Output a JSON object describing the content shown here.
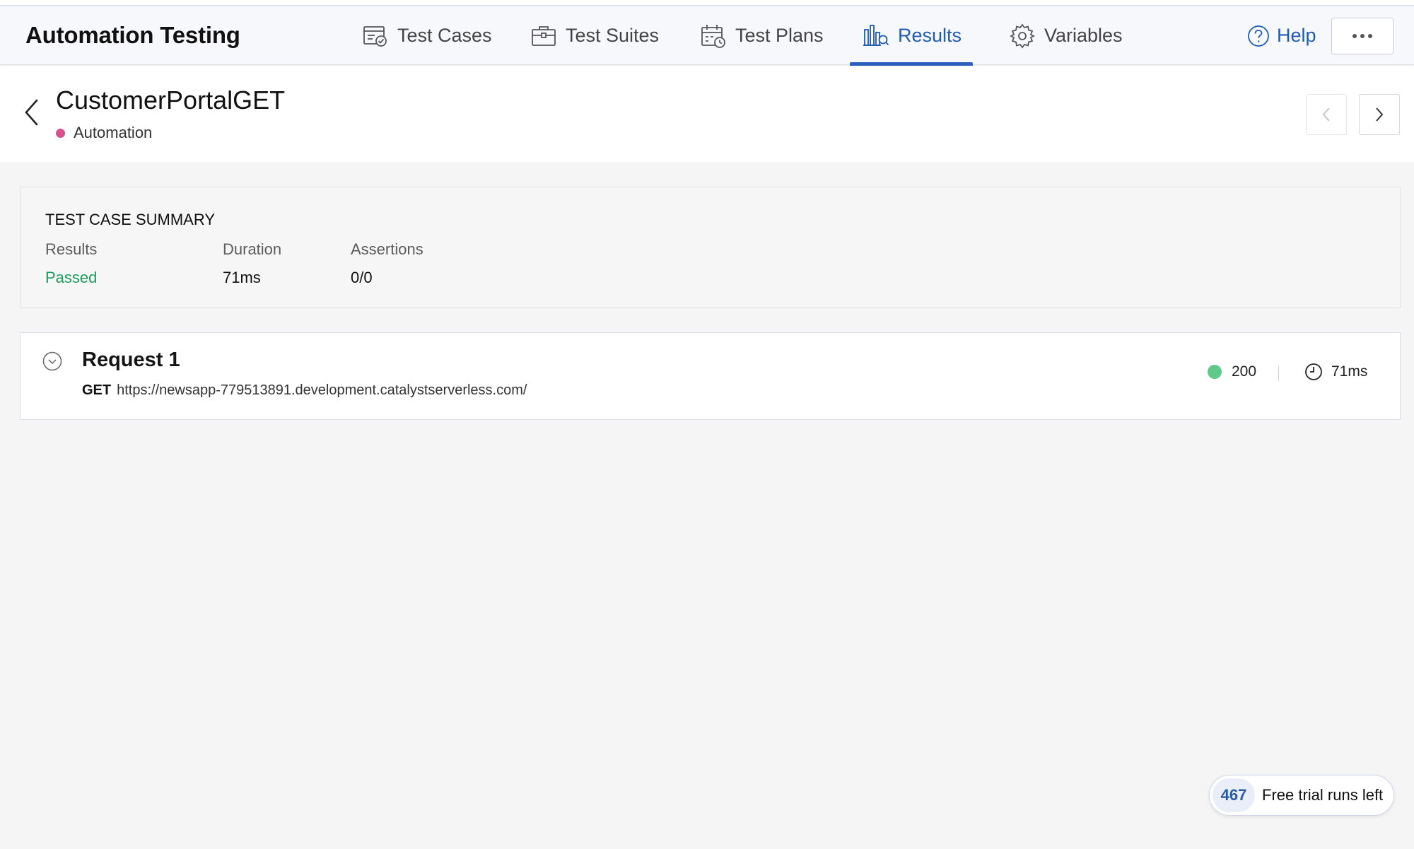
{
  "header": {
    "app_title": "Automation Testing",
    "tabs": [
      {
        "label": "Test Cases",
        "icon": "test-cases-icon",
        "active": false
      },
      {
        "label": "Test Suites",
        "icon": "briefcase-icon",
        "active": false
      },
      {
        "label": "Test Plans",
        "icon": "calendar-clock-icon",
        "active": false
      },
      {
        "label": "Results",
        "icon": "results-chart-icon",
        "active": true
      },
      {
        "label": "Variables",
        "icon": "gear-icon",
        "active": false
      }
    ],
    "help_label": "Help",
    "more_icon": "ellipsis-icon"
  },
  "page": {
    "title": "CustomerPortalGET",
    "tag": "Automation",
    "tag_color": "#d9508e"
  },
  "summary": {
    "heading": "TEST CASE SUMMARY",
    "results_label": "Results",
    "results_value": "Passed",
    "duration_label": "Duration",
    "duration_value": "71ms",
    "assertions_label": "Assertions",
    "assertions_value": "0/0"
  },
  "request": {
    "title": "Request 1",
    "method": "GET",
    "url": "https://newsapp-779513891.development.catalystserverless.com/",
    "status_code": "200",
    "status_color": "#5fc98b",
    "time": "71ms"
  },
  "trial": {
    "count": "467",
    "label": "Free trial runs left"
  },
  "colors": {
    "accent": "#1f5bb5",
    "passed": "#1f9a5f"
  }
}
